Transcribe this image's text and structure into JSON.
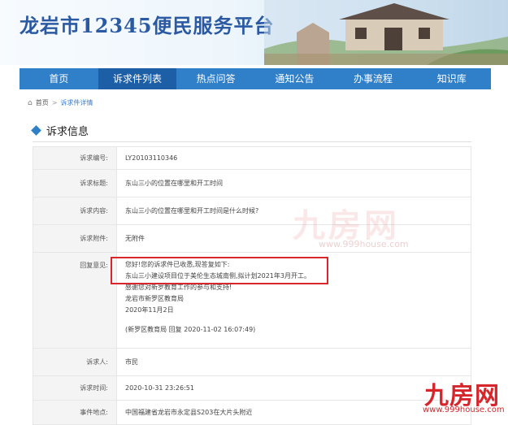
{
  "site": {
    "title": "龙岩市12345便民服务平台"
  },
  "nav": {
    "items": [
      {
        "label": "首页"
      },
      {
        "label": "诉求件列表"
      },
      {
        "label": "热点问答"
      },
      {
        "label": "通知公告"
      },
      {
        "label": "办事流程"
      },
      {
        "label": "知识库"
      }
    ]
  },
  "breadcrumb": {
    "home": "首页",
    "separator": ">",
    "current": "诉求件详情"
  },
  "section": {
    "title": "诉求信息"
  },
  "detail": {
    "rows": [
      {
        "label": "诉求编号:",
        "value": "LY20103110346"
      },
      {
        "label": "诉求标题:",
        "value": "东山三小的位置在哪里和开工时间"
      },
      {
        "label": "诉求内容:",
        "value": "东山三小的位置在哪里和开工时间是什么时候?"
      },
      {
        "label": "诉求附件:",
        "value": "无附件"
      }
    ],
    "reply": {
      "label": "回复意见:",
      "lines": [
        "您好!您的诉求件已收悉,现答复如下:",
        "东山三小建设项目位于美伦生态城南侧,拟计划2021年3月开工。",
        "感谢您对新罗教育工作的参与和支持!",
        "龙岩市新罗区教育局",
        "2020年11月2日",
        "",
        "(新罗区教育局 回复 2020-11-02 16:07:49)"
      ]
    },
    "rows2": [
      {
        "label": "诉求人:",
        "value": "市民"
      },
      {
        "label": "诉求时间:",
        "value": "2020-10-31 23:26:51"
      },
      {
        "label": "事件地点:",
        "value": "中国福建省龙岩市永定县S203在大片头附近"
      }
    ]
  },
  "watermark": {
    "brand": "九房网",
    "url": "www.999house.com"
  },
  "colors": {
    "nav": "#2f7fc9",
    "nav_active": "#1d5fa6",
    "highlight": "#d9262c"
  }
}
